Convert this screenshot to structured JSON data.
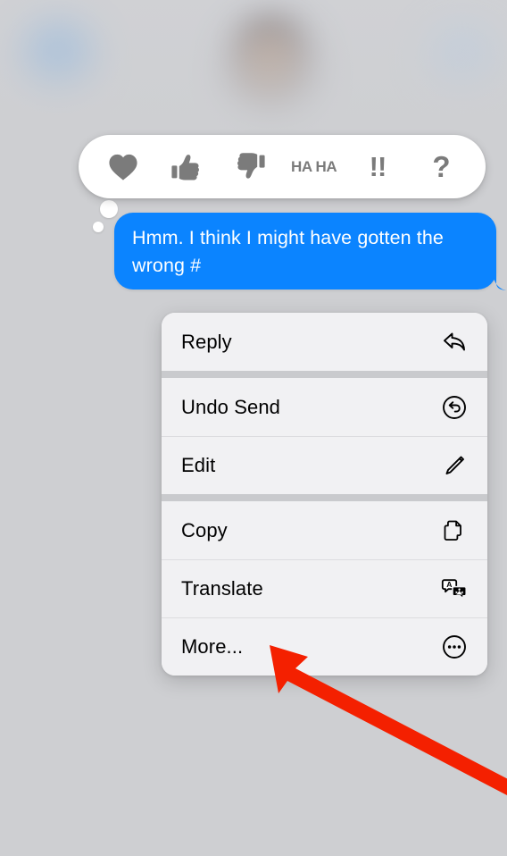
{
  "background": {
    "page_color": "#cecfd2",
    "header": {
      "back_icon": "chevron-left-icon",
      "avatar": "contact-avatar",
      "right_control": "video-call-icon"
    }
  },
  "tapback_bar": {
    "name": "tapback-reaction-bar",
    "reactions": [
      {
        "id": "heart",
        "icon": "heart-icon",
        "label": "Love"
      },
      {
        "id": "thumbsup",
        "icon": "thumbs-up-icon",
        "label": "Like"
      },
      {
        "id": "thumbsdown",
        "icon": "thumbs-down-icon",
        "label": "Dislike"
      },
      {
        "id": "haha",
        "icon": "haha-icon",
        "label": "HA\nHA"
      },
      {
        "id": "exclamation",
        "icon": "exclamation-icon",
        "label": "!!"
      },
      {
        "id": "question",
        "icon": "question-icon",
        "label": "?"
      }
    ]
  },
  "message": {
    "text": "Hmm. I think I might have gotten the wrong #",
    "bubble_color": "#0b84ff",
    "text_color": "#ffffff",
    "direction": "outgoing"
  },
  "context_menu": {
    "groups": [
      {
        "items": [
          {
            "label": "Reply",
            "icon": "reply-arrow-icon"
          }
        ]
      },
      {
        "items": [
          {
            "label": "Undo Send",
            "icon": "undo-circle-icon"
          },
          {
            "label": "Edit",
            "icon": "pencil-icon"
          }
        ]
      },
      {
        "items": [
          {
            "label": "Copy",
            "icon": "copy-documents-icon"
          },
          {
            "label": "Translate",
            "icon": "translate-bubbles-icon"
          },
          {
            "label": "More...",
            "icon": "ellipsis-circle-icon"
          }
        ]
      }
    ]
  },
  "annotation": {
    "arrow_color": "#f42000",
    "points_to": "More..."
  }
}
